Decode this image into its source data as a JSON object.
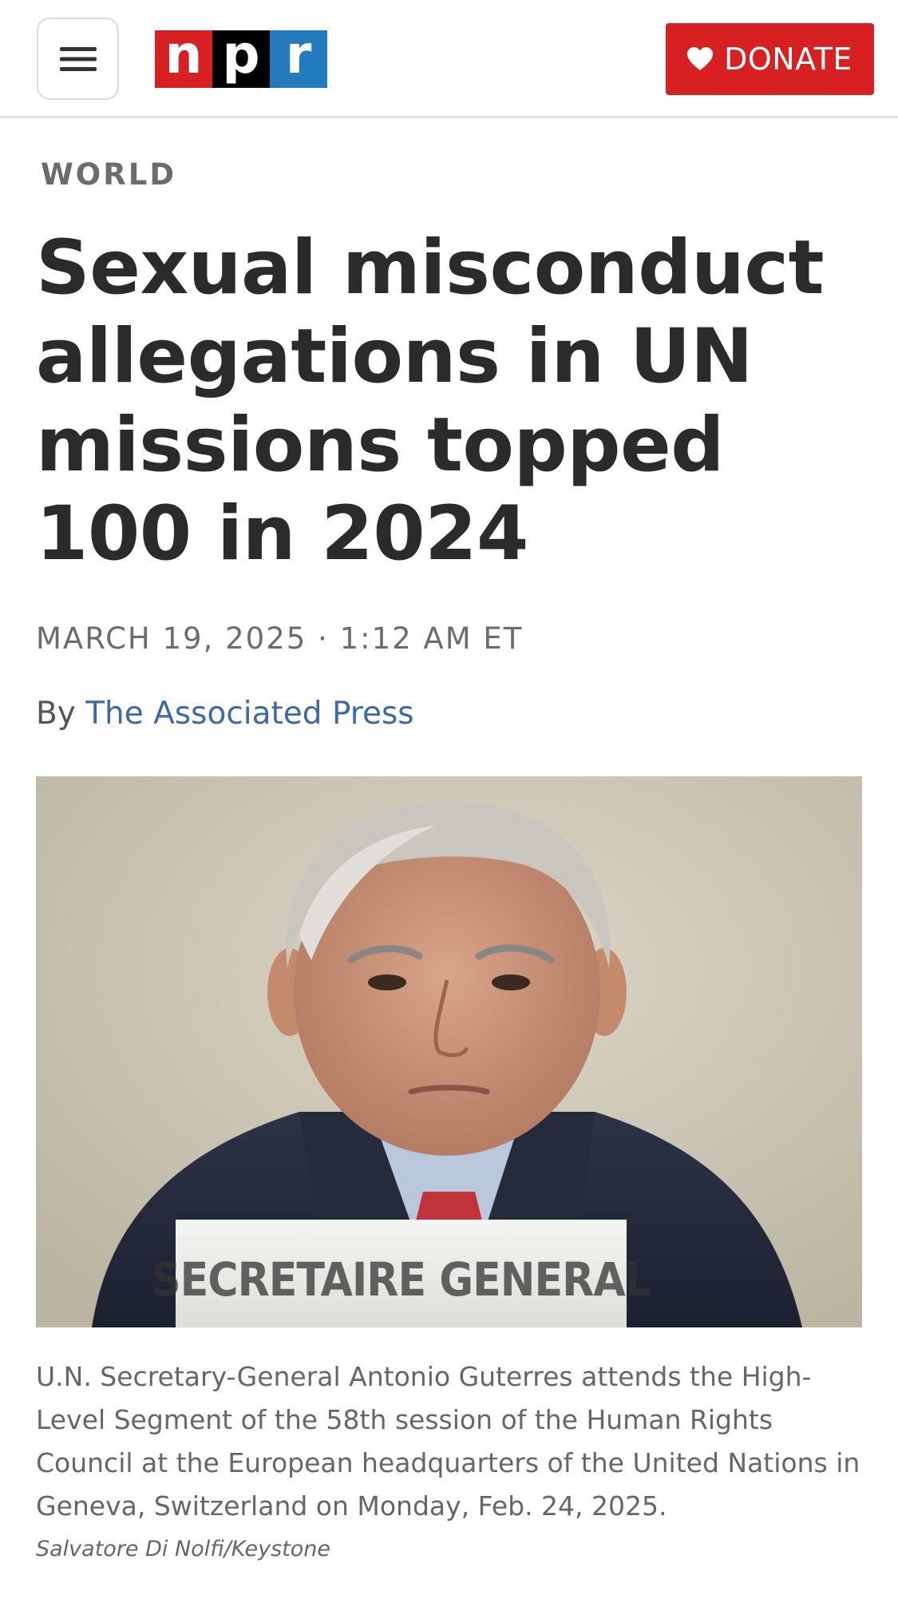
{
  "header": {
    "menu_icon": "hamburger-menu-icon",
    "logo_letters": [
      "n",
      "p",
      "r"
    ],
    "logo_colors": [
      "#d62021",
      "#000000",
      "#237bbd"
    ],
    "donate_label": "DONATE",
    "donate_icon": "heart-icon",
    "donate_color": "#d62021"
  },
  "article": {
    "section": "WORLD",
    "headline": "Sexual misconduct allegations in UN missions topped 100 in 2024",
    "dateline": "MARCH 19, 2025 · 1:12 AM ET",
    "byline_prefix": "By ",
    "author": "The Associated Press",
    "photo": {
      "placard_text": "SECRETAIRE GENERAL",
      "caption": "U.N. Secretary-General Antonio Guterres attends the High-Level Segment of the 58th session of the Human Rights Council at the European headquarters of the United Nations in Geneva, Switzerland on Monday, Feb. 24, 2025.",
      "credit": "Salvatore Di Nolfi/Keystone"
    }
  }
}
